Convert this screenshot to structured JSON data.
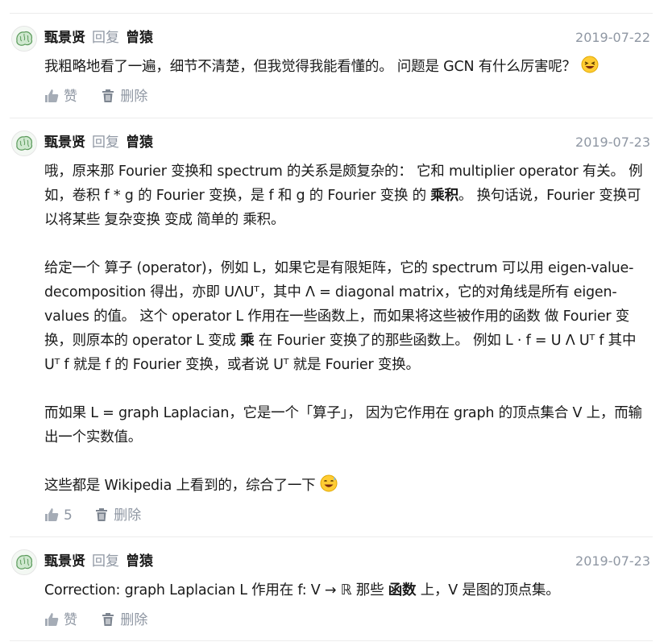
{
  "comments": [
    {
      "author": "甄景贤",
      "reply_label": "回复",
      "target": "曾猿",
      "date": "2019-07-22",
      "text": "我粗略地看了一遍，细节不清楚，但我觉得我能看懂的。 问题是 GCN 有什么厉害呢？",
      "emoji": "laughing-emoji",
      "like_label": "赞",
      "delete_label": "删除"
    },
    {
      "author": "甄景贤",
      "reply_label": "回复",
      "target": "曾猿",
      "date": "2019-07-23",
      "p1_a": "哦，原来那 Fourier 变换和 spectrum 的关系是颇复杂的： 它和 multiplier operator 有关。 例如，卷积 f * g 的 Fourier 变换，是 f 和 g 的 Fourier 变换 的 ",
      "p1_bold": "乘积",
      "p1_b": "。 换句话说，Fourier 变换可以将某些 复杂变换 变成 简单的 乘积。",
      "p2_a": "给定一个 算子 (operator)，例如 L，如果它是有限矩阵，它的 spectrum 可以用 eigen-value-decomposition 得出，亦即 UΛUᵀ，其中 Λ = diagonal matrix，它的对角线是所有 eigen-values 的值。 这个 operator L 作用在一些函数上，而如果将这些被作用的函数 做 Fourier 变换，则原本的 operator L 变成 ",
      "p2_bold": "乘",
      "p2_b": " 在 Fourier 变换了的那些函数上。 例如 L · f = U Λ Uᵀ f 其中 Uᵀ f 就是 f 的 Fourier 变换，或者说 Uᵀ 就是 Fourier 变换。",
      "p3": "而如果 L = graph Laplacian，它是一个「算子」， 因为它作用在 graph 的顶点集合 V 上，而输出一个实数值。",
      "p4": "这些都是 Wikipedia 上看到的，综合了一下",
      "emoji": "sweat-smile-emoji",
      "like_count": "5",
      "delete_label": "删除"
    },
    {
      "author": "甄景贤",
      "reply_label": "回复",
      "target": "曾猿",
      "date": "2019-07-23",
      "text_a": "Correction: graph Laplacian L 作用在 f: V → ℝ 那些 ",
      "text_bold": "函数",
      "text_b": " 上，V 是图的顶点集。",
      "like_label": "赞",
      "delete_label": "删除"
    }
  ],
  "colors": {
    "muted": "#8f97a3",
    "separator": "#ececec",
    "text": "#1a1a1a"
  }
}
